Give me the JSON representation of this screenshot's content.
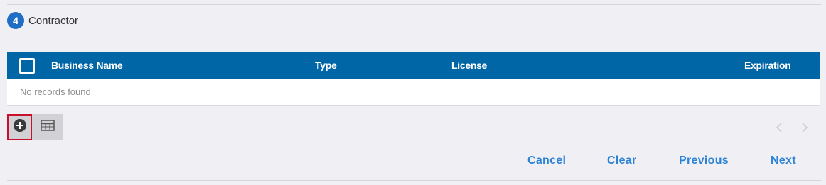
{
  "section": {
    "step_number": "4",
    "title": "Contractor"
  },
  "grid": {
    "columns": [
      "Business Name",
      "Type",
      "License",
      "Expiration"
    ],
    "empty_message": "No records found"
  },
  "toolbar": {
    "add_icon": "add-circle-icon",
    "table_icon": "table-icon"
  },
  "pager": {
    "prev_icon": "chevron-left-icon",
    "next_icon": "chevron-right-icon"
  },
  "actions": {
    "cancel": "Cancel",
    "clear": "Clear",
    "previous": "Previous",
    "next": "Next"
  },
  "colors": {
    "header_bg": "#0066a6",
    "badge_bg": "#1f6dc4",
    "action_text": "#2c83d6",
    "highlight_border": "#c8102e"
  }
}
